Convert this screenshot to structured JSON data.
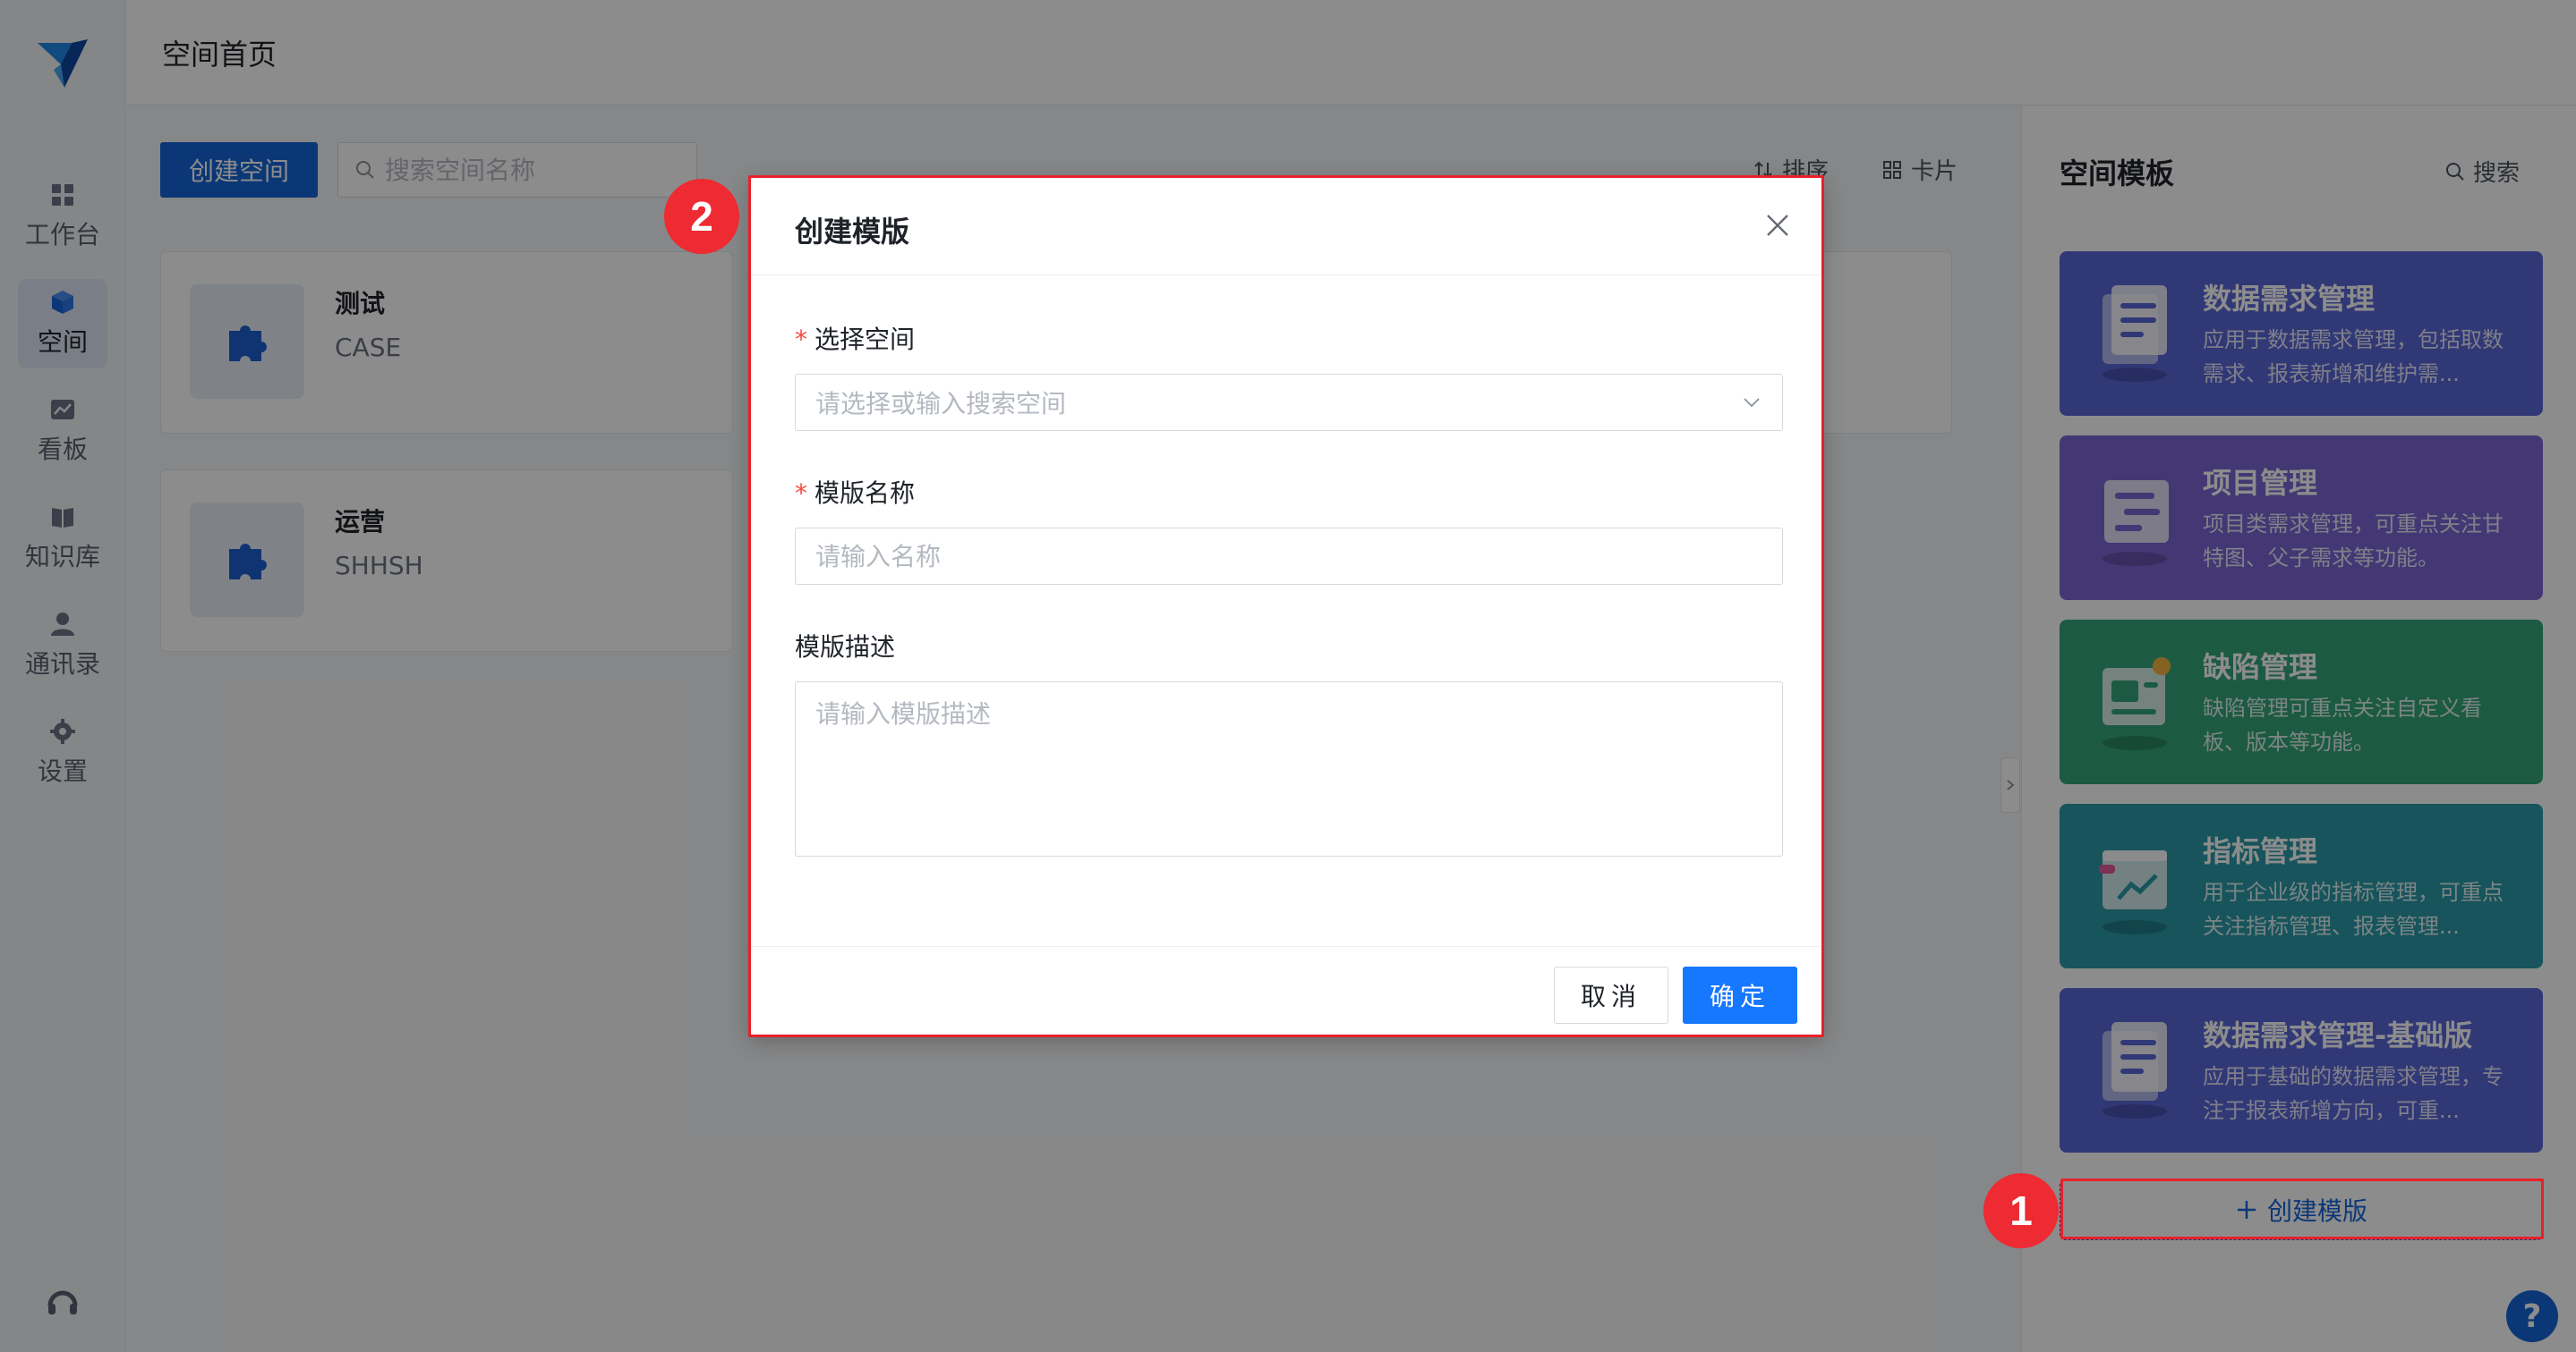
{
  "sidebar": {
    "items": [
      {
        "label": "工作台",
        "icon": "dashboard-icon"
      },
      {
        "label": "空间",
        "icon": "cube-icon",
        "active": true
      },
      {
        "label": "看板",
        "icon": "chart-icon"
      },
      {
        "label": "知识库",
        "icon": "book-icon"
      },
      {
        "label": "通讯录",
        "icon": "user-icon"
      },
      {
        "label": "设置",
        "icon": "gear-icon"
      }
    ]
  },
  "header": {
    "title": "空间首页"
  },
  "toolbar": {
    "create_space_label": "创建空间",
    "search_placeholder": "搜索空间名称",
    "sort_label": "排序",
    "view_label": "卡片"
  },
  "spaces": [
    {
      "name": "测试",
      "code": "CASE"
    },
    {
      "name": "运营",
      "code": "SHHSH"
    }
  ],
  "template_panel": {
    "title": "空间模板",
    "search_label": "搜索",
    "templates": [
      {
        "title": "数据需求管理",
        "desc": "应用于数据需求管理，包括取数需求、报表新增和维护需...",
        "color": "#5a66d8"
      },
      {
        "title": "项目管理",
        "desc": "项目类需求管理，可重点关注甘特图、父子需求等功能。",
        "color": "#7a66d4"
      },
      {
        "title": "缺陷管理",
        "desc": "缺陷管理可重点关注自定义看板、版本等功能。",
        "color": "#33a57a"
      },
      {
        "title": "指标管理",
        "desc": "用于企业级的指标管理，可重点关注指标管理、报表管理...",
        "color": "#2a9aa8"
      },
      {
        "title": "数据需求管理-基础版",
        "desc": "应用于基础的数据需求管理，专注于报表新增方向，可重...",
        "color": "#5a66d8"
      }
    ],
    "create_template_label": "创建模版"
  },
  "modal": {
    "title": "创建模版",
    "space_label": "选择空间",
    "space_placeholder": "请选择或输入搜索空间",
    "name_label": "模版名称",
    "name_placeholder": "请输入名称",
    "desc_label": "模版描述",
    "desc_placeholder": "请输入模版描述",
    "cancel_label": "取消",
    "ok_label": "确定"
  },
  "annotations": {
    "step1": "1",
    "step2": "2"
  },
  "help_label": "?",
  "colors": {
    "primary": "#1565d8",
    "confirm": "#1677ff",
    "annotation": "#e8202a"
  }
}
